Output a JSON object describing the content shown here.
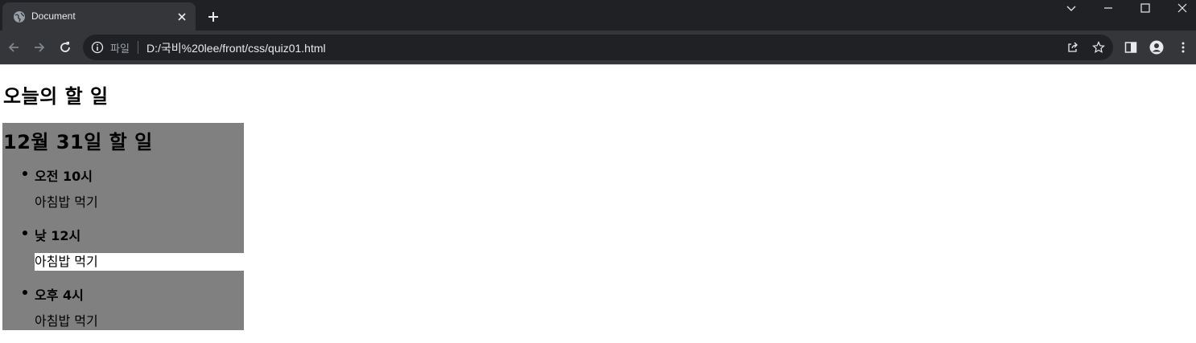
{
  "browser": {
    "tab_title": "Document",
    "scheme_label": "파일",
    "url": "D:/국비%20lee/front/css/quiz01.html"
  },
  "page": {
    "title": "오늘의 할 일",
    "panel_title": "12월 31일 할 일",
    "items": [
      {
        "time": "오전 10시",
        "desc": "아침밥 먹기",
        "highlighted": false
      },
      {
        "time": "낮 12시",
        "desc": "아침밥 먹기",
        "highlighted": true
      },
      {
        "time": "오후 4시",
        "desc": "아침밥 먹기",
        "highlighted": false
      }
    ]
  },
  "colors": {
    "panel_bg": "#808080",
    "highlight_bg": "#ffffff",
    "chrome_dark": "#202124",
    "chrome_toolbar": "#35363a"
  },
  "icons": [
    "globe-icon",
    "close-icon",
    "plus-icon",
    "chevron-down-icon",
    "minimize-icon",
    "maximize-icon",
    "window-close-icon",
    "back-icon",
    "forward-icon",
    "reload-icon",
    "info-icon",
    "share-icon",
    "star-icon",
    "side-panel-icon",
    "profile-icon",
    "menu-icon"
  ]
}
